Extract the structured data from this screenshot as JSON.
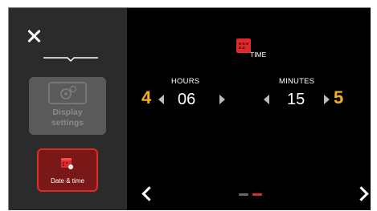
{
  "sidebar": {
    "close_icon": "close-icon",
    "items": [
      {
        "label_line1": "Display",
        "label_line2": "settings",
        "icon": "gear-icon",
        "state": "disabled"
      },
      {
        "label": "Date & time",
        "icon": "calendar-icon",
        "state": "active"
      }
    ]
  },
  "page": {
    "title": "TIME",
    "title_icon": "calendar-icon",
    "hours": {
      "label": "HOURS",
      "value": "06",
      "badge": "4"
    },
    "minutes": {
      "label": "MINUTES",
      "value": "15",
      "badge": "5"
    }
  },
  "pager": {
    "pages": 2,
    "current": 2
  },
  "colors": {
    "accent": "#e02a2a",
    "badge": "#f4b020",
    "background": "#000000",
    "sidebar": "#2b2b2b"
  }
}
